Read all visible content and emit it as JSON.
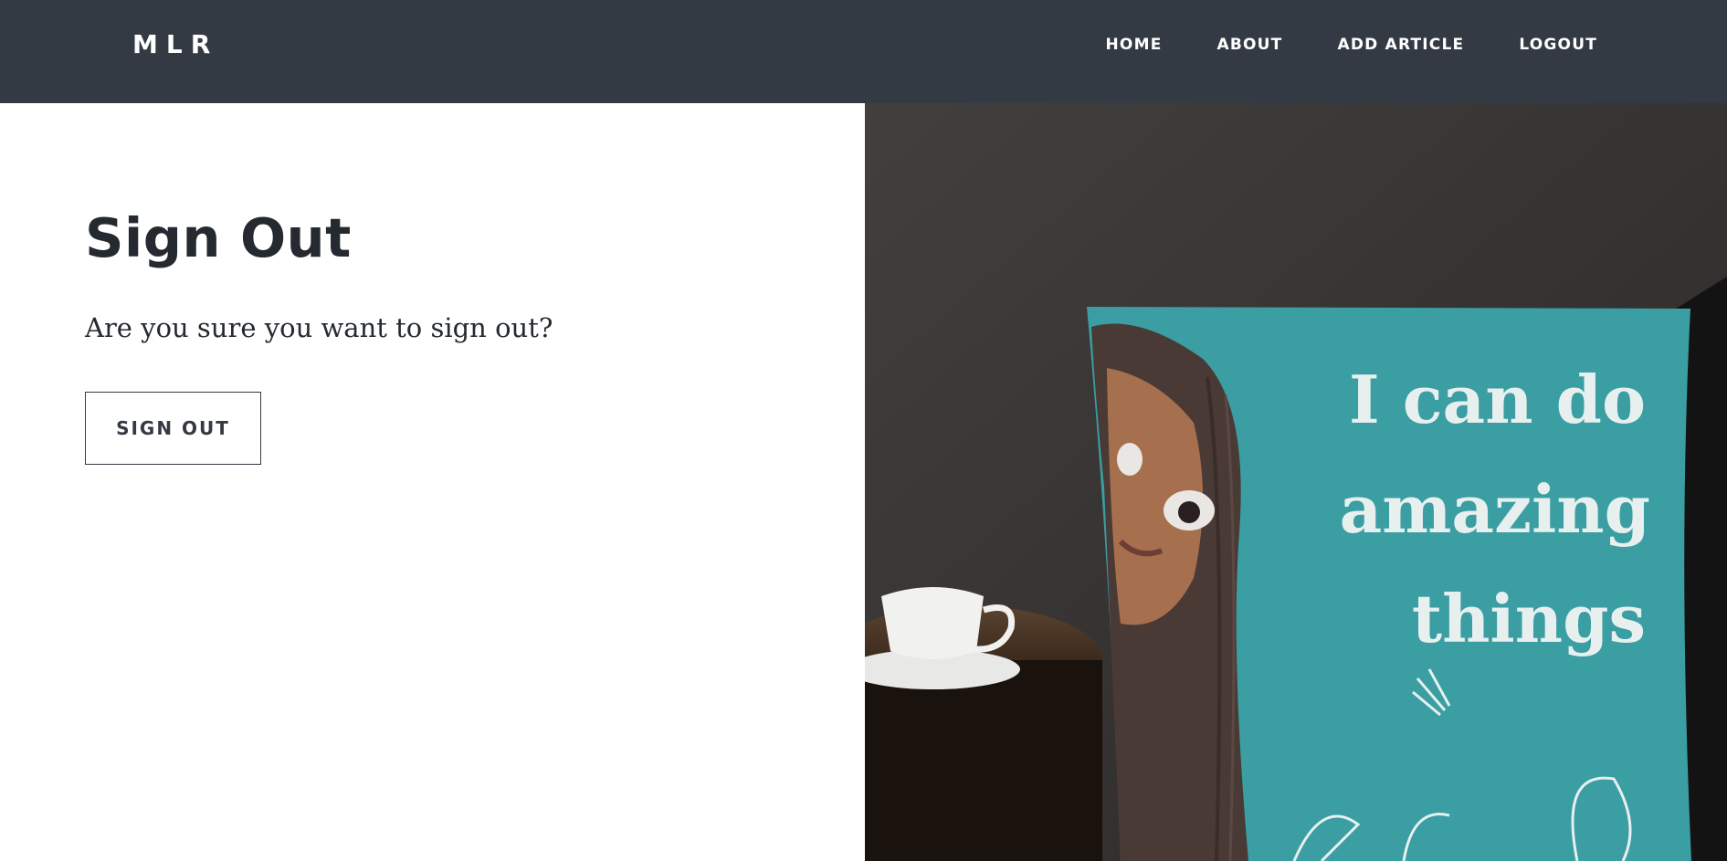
{
  "navbar": {
    "brand": "MLR",
    "links": [
      {
        "label": "HOME"
      },
      {
        "label": "ABOUT"
      },
      {
        "label": "ADD ARTICLE"
      },
      {
        "label": "LOGOUT"
      }
    ]
  },
  "main": {
    "title": "Sign Out",
    "question": "Are you sure you want to sign out?",
    "button_label": "SIGN OUT"
  },
  "hero": {
    "pillow_text_lines": [
      "I can do",
      "amazing",
      "things"
    ]
  },
  "colors": {
    "navbar_bg": "#343a44",
    "text_dark": "#252a31",
    "pillow_teal": "#3a9ea3",
    "wall": "#3a3837"
  }
}
